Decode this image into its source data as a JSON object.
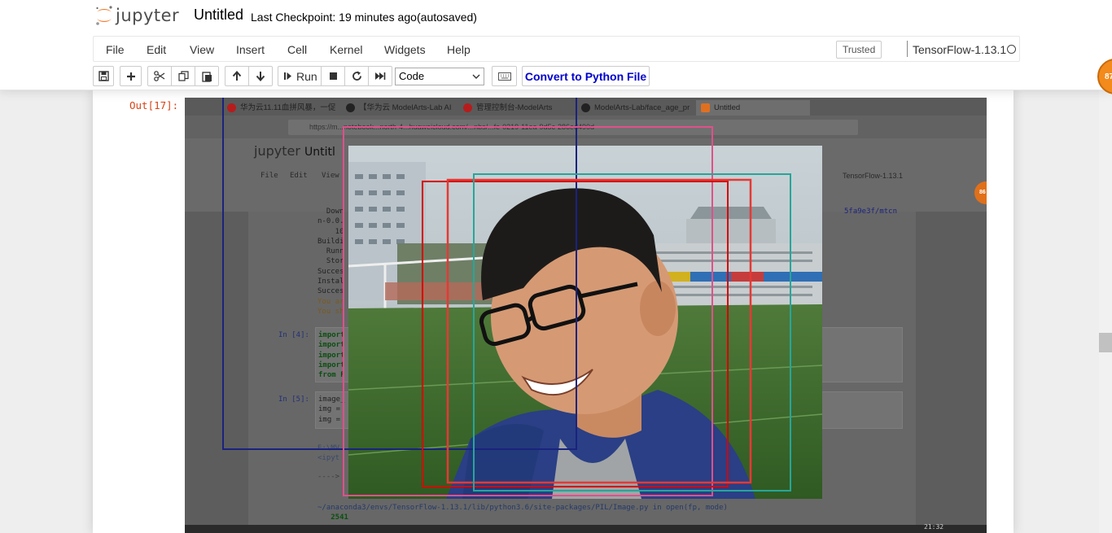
{
  "header": {
    "logo_text": "jupyter",
    "notebook_name": "Untitled",
    "checkpoint": "Last Checkpoint: 19 minutes ago",
    "autosave": "(autosaved)"
  },
  "menu": {
    "items": [
      "File",
      "Edit",
      "View",
      "Insert",
      "Cell",
      "Kernel",
      "Widgets",
      "Help"
    ],
    "trusted": "Trusted",
    "kernel_name": "TensorFlow-1.13.1"
  },
  "toolbar": {
    "run_label": "Run",
    "cell_type": "Code",
    "convert_label": "Convert to Python File"
  },
  "badge": {
    "count": "87"
  },
  "output": {
    "prompt": "Out[17]:",
    "browser_tabs": [
      "华为云11.11血拼风暴，一促",
      "【华为云 ModelArts-Lab AI",
      "管理控制台-ModelArts",
      "ModelArts-Lab/face_age_pr",
      "Untitled"
    ],
    "address": "https://m...notebook...north-4...huaweicloud.com/...nbs/...fe-0219-11ea-9d5c-286ed490d",
    "inner_logo": "jupyter",
    "inner_title": "Untitl",
    "inner_menu": [
      "File",
      "Edit",
      "View"
    ],
    "inner_kernel": "TensorFlow-1.13.1",
    "inner_badge": "86",
    "inner_side_text": "5fa9e3f/mtcn",
    "inner_log": [
      "  Down",
      "n-0.0.",
      "    10",
      "Buildi",
      "  Runn",
      "  Stor",
      "Succes",
      "Instal",
      "Succes",
      "You ar",
      "You sh"
    ],
    "inner_in4_prompt": "In  [4]:",
    "inner_in4_code": [
      "import",
      "import",
      "import",
      "import",
      "from F"
    ],
    "inner_in5_prompt": "In  [5]:",
    "inner_in5_code": [
      "image_",
      "img = ",
      "img = "
    ],
    "inner_err": [
      "E:\\MV",
      "<ipyt",
      "---->"
    ],
    "inner_trace": "~/anaconda3/envs/TensorFlow-1.13.1/lib/python3.6/site-packages/PIL/Image.py in open(fp, mode)",
    "inner_trace_line": "   2541",
    "inner_clock": "21:32"
  },
  "colors": {
    "prompt_out": "#d84315",
    "convert_text": "#0000cc",
    "badge": "#f38a1c",
    "box_navy": "#1a237e",
    "box_pink": "#e0508a",
    "box_red": "#d50000",
    "box_red2": "#e53935",
    "box_teal": "#26a69a"
  }
}
